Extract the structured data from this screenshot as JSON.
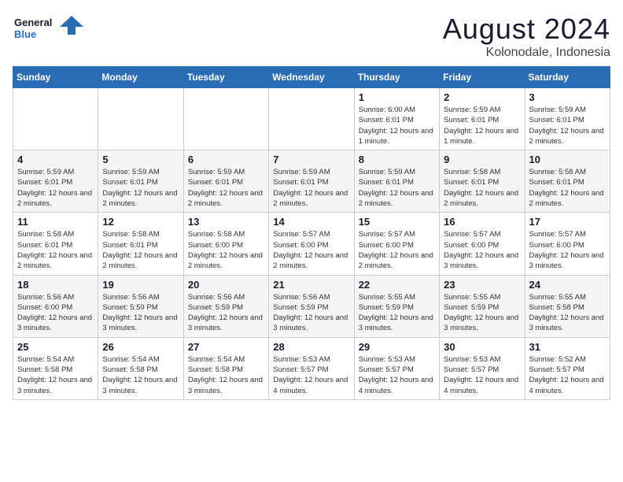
{
  "logo": {
    "line1": "General",
    "line2": "Blue"
  },
  "title": "August 2024",
  "location": "Kolonodale, Indonesia",
  "weekdays": [
    "Sunday",
    "Monday",
    "Tuesday",
    "Wednesday",
    "Thursday",
    "Friday",
    "Saturday"
  ],
  "weeks": [
    [
      {
        "day": "",
        "info": ""
      },
      {
        "day": "",
        "info": ""
      },
      {
        "day": "",
        "info": ""
      },
      {
        "day": "",
        "info": ""
      },
      {
        "day": "1",
        "info": "Sunrise: 6:00 AM\nSunset: 6:01 PM\nDaylight: 12 hours and 1 minute."
      },
      {
        "day": "2",
        "info": "Sunrise: 5:59 AM\nSunset: 6:01 PM\nDaylight: 12 hours and 1 minute."
      },
      {
        "day": "3",
        "info": "Sunrise: 5:59 AM\nSunset: 6:01 PM\nDaylight: 12 hours and 2 minutes."
      }
    ],
    [
      {
        "day": "4",
        "info": "Sunrise: 5:59 AM\nSunset: 6:01 PM\nDaylight: 12 hours and 2 minutes."
      },
      {
        "day": "5",
        "info": "Sunrise: 5:59 AM\nSunset: 6:01 PM\nDaylight: 12 hours and 2 minutes."
      },
      {
        "day": "6",
        "info": "Sunrise: 5:59 AM\nSunset: 6:01 PM\nDaylight: 12 hours and 2 minutes."
      },
      {
        "day": "7",
        "info": "Sunrise: 5:59 AM\nSunset: 6:01 PM\nDaylight: 12 hours and 2 minutes."
      },
      {
        "day": "8",
        "info": "Sunrise: 5:59 AM\nSunset: 6:01 PM\nDaylight: 12 hours and 2 minutes."
      },
      {
        "day": "9",
        "info": "Sunrise: 5:58 AM\nSunset: 6:01 PM\nDaylight: 12 hours and 2 minutes."
      },
      {
        "day": "10",
        "info": "Sunrise: 5:58 AM\nSunset: 6:01 PM\nDaylight: 12 hours and 2 minutes."
      }
    ],
    [
      {
        "day": "11",
        "info": "Sunrise: 5:58 AM\nSunset: 6:01 PM\nDaylight: 12 hours and 2 minutes."
      },
      {
        "day": "12",
        "info": "Sunrise: 5:58 AM\nSunset: 6:01 PM\nDaylight: 12 hours and 2 minutes."
      },
      {
        "day": "13",
        "info": "Sunrise: 5:58 AM\nSunset: 6:00 PM\nDaylight: 12 hours and 2 minutes."
      },
      {
        "day": "14",
        "info": "Sunrise: 5:57 AM\nSunset: 6:00 PM\nDaylight: 12 hours and 2 minutes."
      },
      {
        "day": "15",
        "info": "Sunrise: 5:57 AM\nSunset: 6:00 PM\nDaylight: 12 hours and 2 minutes."
      },
      {
        "day": "16",
        "info": "Sunrise: 5:57 AM\nSunset: 6:00 PM\nDaylight: 12 hours and 3 minutes."
      },
      {
        "day": "17",
        "info": "Sunrise: 5:57 AM\nSunset: 6:00 PM\nDaylight: 12 hours and 3 minutes."
      }
    ],
    [
      {
        "day": "18",
        "info": "Sunrise: 5:56 AM\nSunset: 6:00 PM\nDaylight: 12 hours and 3 minutes."
      },
      {
        "day": "19",
        "info": "Sunrise: 5:56 AM\nSunset: 5:59 PM\nDaylight: 12 hours and 3 minutes."
      },
      {
        "day": "20",
        "info": "Sunrise: 5:56 AM\nSunset: 5:59 PM\nDaylight: 12 hours and 3 minutes."
      },
      {
        "day": "21",
        "info": "Sunrise: 5:56 AM\nSunset: 5:59 PM\nDaylight: 12 hours and 3 minutes."
      },
      {
        "day": "22",
        "info": "Sunrise: 5:55 AM\nSunset: 5:59 PM\nDaylight: 12 hours and 3 minutes."
      },
      {
        "day": "23",
        "info": "Sunrise: 5:55 AM\nSunset: 5:59 PM\nDaylight: 12 hours and 3 minutes."
      },
      {
        "day": "24",
        "info": "Sunrise: 5:55 AM\nSunset: 5:58 PM\nDaylight: 12 hours and 3 minutes."
      }
    ],
    [
      {
        "day": "25",
        "info": "Sunrise: 5:54 AM\nSunset: 5:58 PM\nDaylight: 12 hours and 3 minutes."
      },
      {
        "day": "26",
        "info": "Sunrise: 5:54 AM\nSunset: 5:58 PM\nDaylight: 12 hours and 3 minutes."
      },
      {
        "day": "27",
        "info": "Sunrise: 5:54 AM\nSunset: 5:58 PM\nDaylight: 12 hours and 3 minutes."
      },
      {
        "day": "28",
        "info": "Sunrise: 5:53 AM\nSunset: 5:57 PM\nDaylight: 12 hours and 4 minutes."
      },
      {
        "day": "29",
        "info": "Sunrise: 5:53 AM\nSunset: 5:57 PM\nDaylight: 12 hours and 4 minutes."
      },
      {
        "day": "30",
        "info": "Sunrise: 5:53 AM\nSunset: 5:57 PM\nDaylight: 12 hours and 4 minutes."
      },
      {
        "day": "31",
        "info": "Sunrise: 5:52 AM\nSunset: 5:57 PM\nDaylight: 12 hours and 4 minutes."
      }
    ]
  ]
}
